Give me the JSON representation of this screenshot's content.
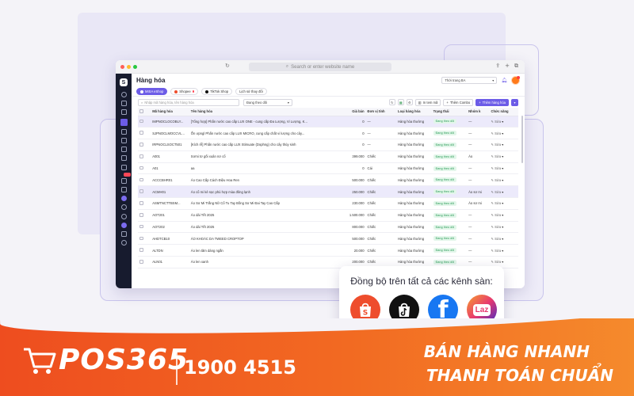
{
  "browser": {
    "url_placeholder": "Search or enter website name",
    "nav_back": "‹",
    "nav_refresh": "↻"
  },
  "app": {
    "logo_letter": "S",
    "page_title": "Hàng hóa",
    "branch_select": "Thời trang BA",
    "channel_tabs": [
      {
        "label": "MISA eShop",
        "active": true
      },
      {
        "label": "Shopee",
        "active": false
      },
      {
        "label": "TikTok Shop",
        "active": false
      },
      {
        "label": "Lịch sử thay đổi",
        "active": false
      }
    ],
    "search_placeholder": "Nhập mã hàng hóa, tên hàng hóa",
    "status_filter": "Đang theo dõi",
    "buttons": {
      "print_barcode": "In tem mã",
      "add_combo": "Thêm Combo",
      "add_product": "Thêm hàng hóa"
    },
    "table": {
      "headers": [
        "",
        "Mã hàng hóa",
        "Tên hàng hóa",
        "Giá bán",
        "Đơn vị tính",
        "Loại hàng hóa",
        "Trạng thái",
        "Nhóm k",
        "Chức năng"
      ],
      "rows": [
        {
          "code": "IMPNOCLOCOBLY...",
          "name": "[Tổng hợp] Phấn nước cao cấp LUX ONE - cung cấp Đa Lượng, Vi Lượng, K...",
          "price": "0",
          "unit": "—",
          "type": "Hàng hóa thường",
          "status": "Đang theo dõi",
          "group": "—",
          "action": "Sửa",
          "selected": true
        },
        {
          "code": "SJPNOCLMOCCVL...",
          "name": "Ổn ưpngl Phấn nước cao cấp LUX MICRO, cung cấp chất vi lượng cho cây...",
          "price": "0",
          "unit": "—",
          "type": "Hàng hóa thường",
          "status": "Đang theo dõi",
          "group": "—",
          "action": "Sửa",
          "selected": false
        },
        {
          "code": "IRPNOCLSOCT501",
          "name": "[Kích rễ] Phấn nước cao cấp LUX Stimuate (Dophng) cho cây thủy sinh",
          "price": "0",
          "unit": "—",
          "type": "Hàng hóa thường",
          "status": "Đang theo dõi",
          "group": "—",
          "action": "Sửa",
          "selected": false
        },
        {
          "code": "A001",
          "name": "Sơmi tơ gối xuân nơ cổ",
          "price": "399.000",
          "unit": "Chiếc",
          "type": "Hàng hóa thường",
          "status": "Đang theo dõi",
          "group": "Áo",
          "action": "Sửa",
          "selected": false
        },
        {
          "code": "A01",
          "name": "aa",
          "price": "0",
          "unit": "Cái",
          "type": "Hàng hóa thường",
          "status": "Đang theo dõi",
          "group": "—",
          "action": "Sửa",
          "selected": false
        },
        {
          "code": "ACCCBHR01",
          "name": "Áo Cao Cấp Cách Điệu Hoa Ren",
          "price": "500.000",
          "unit": "Chiếc",
          "type": "Hàng hóa thường",
          "status": "Đang theo dõi",
          "group": "—",
          "action": "Sửa",
          "selected": false
        },
        {
          "code": "ACMH01",
          "name": "Áo cổ mi kẻ sọc phù hợp mùa đông lạnh",
          "price": "250.000",
          "unit": "Chiếc",
          "type": "Hàng hóa thường",
          "status": "Đang theo dõi",
          "group": "Áo sơ mi",
          "action": "Sửa",
          "selected": true
        },
        {
          "code": "ASMTNCTTBSM...",
          "name": "Áo Sơ Mi Trắng Nữ Cổ Tu Tay Bồng Sơ Mi Đai Tay Cao Cấp",
          "price": "230.000",
          "unit": "Chiếc",
          "type": "Hàng hóa thường",
          "status": "Đang theo dõi",
          "group": "Áo sơ mi",
          "action": "Sửa",
          "selected": false
        },
        {
          "code": "AOT201",
          "name": "Áo dài Tết 2025",
          "price": "1.500.000",
          "unit": "Chiếc",
          "type": "Hàng hóa thường",
          "status": "Đang theo dõi",
          "group": "—",
          "action": "Sửa",
          "selected": false
        },
        {
          "code": "AOT202",
          "name": "Áo dài Tết 2025",
          "price": "800.000",
          "unit": "Chiếc",
          "type": "Hàng hóa thường",
          "status": "Đang theo dõi",
          "group": "—",
          "action": "Sửa",
          "selected": false
        },
        {
          "code": "AHDTCB10",
          "name": "ÁO KHOÁC DA TWEED CROPTOP",
          "price": "500.000",
          "unit": "Chiếc",
          "type": "Hàng hóa thường",
          "status": "Đang theo dõi",
          "group": "—",
          "action": "Sửa",
          "selected": false
        },
        {
          "code": "ALTDN",
          "name": "Áo len tăm dáng ngắn",
          "price": "20.000",
          "unit": "Chiếc",
          "type": "Hàng hóa thường",
          "status": "Đang theo dõi",
          "group": "—",
          "action": "Sửa",
          "selected": false
        },
        {
          "code": "ALN01",
          "name": "Áo len xanh",
          "price": "200.000",
          "unit": "Chiếc",
          "type": "Hàng hóa thường",
          "status": "Đang theo dõi",
          "group": "—",
          "action": "Sửa",
          "selected": false
        }
      ]
    }
  },
  "sync_card": {
    "title": "Đồng bộ trên tất cả các kênh sàn:",
    "channels": [
      {
        "name": "Shopee",
        "icon": "shopee-icon",
        "color": "#ee4d2d"
      },
      {
        "name": "TikTok Shop",
        "icon": "tiktok-shop-icon",
        "color": "#111111"
      },
      {
        "name": "Facebook",
        "icon": "facebook-icon",
        "color": "#1877f2"
      },
      {
        "name": "Lazada",
        "icon": "lazada-icon",
        "color": "#3a2bc9"
      }
    ],
    "facebook_glyph": "f",
    "lazada_glyph": "Laz"
  },
  "footer": {
    "brand": "POS365",
    "hotline": "1900 4515",
    "slogan_line1": "BÁN HÀNG NHANH",
    "slogan_line2": "THANH TOÁN CHUẨN"
  },
  "colors": {
    "accent": "#6c5ce7",
    "sidebar": "#171b2e",
    "footer_orange": "#f26a22"
  }
}
